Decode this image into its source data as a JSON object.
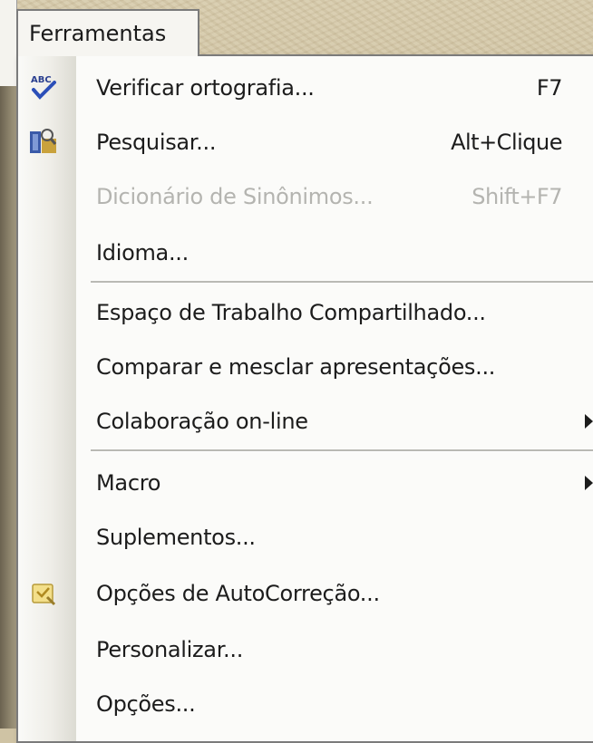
{
  "menu": {
    "title": "Ferramentas",
    "items": [
      {
        "label": "Verificar ortografia...",
        "shortcut": "F7",
        "icon": "spell-check-icon",
        "enabled": true
      },
      {
        "label": "Pesquisar...",
        "shortcut": "Alt+Clique",
        "icon": "research-icon",
        "enabled": true
      },
      {
        "label": "Dicionário de Sinônimos...",
        "shortcut": "Shift+F7",
        "enabled": false
      },
      {
        "label": "Idioma...",
        "enabled": true
      },
      {
        "label": "Espaço de Trabalho Compartilhado...",
        "enabled": true
      },
      {
        "label": "Comparar e mesclar apresentações...",
        "enabled": true
      },
      {
        "label": "Colaboração on-line",
        "submenu": true,
        "enabled": true
      },
      {
        "label": "Macro",
        "submenu": true,
        "enabled": true
      },
      {
        "label": "Suplementos...",
        "enabled": true
      },
      {
        "label": "Opções de AutoCorreção...",
        "icon": "autocorrect-icon",
        "enabled": true
      },
      {
        "label": "Personalizar...",
        "enabled": true
      },
      {
        "label": "Opções...",
        "enabled": true
      }
    ]
  }
}
